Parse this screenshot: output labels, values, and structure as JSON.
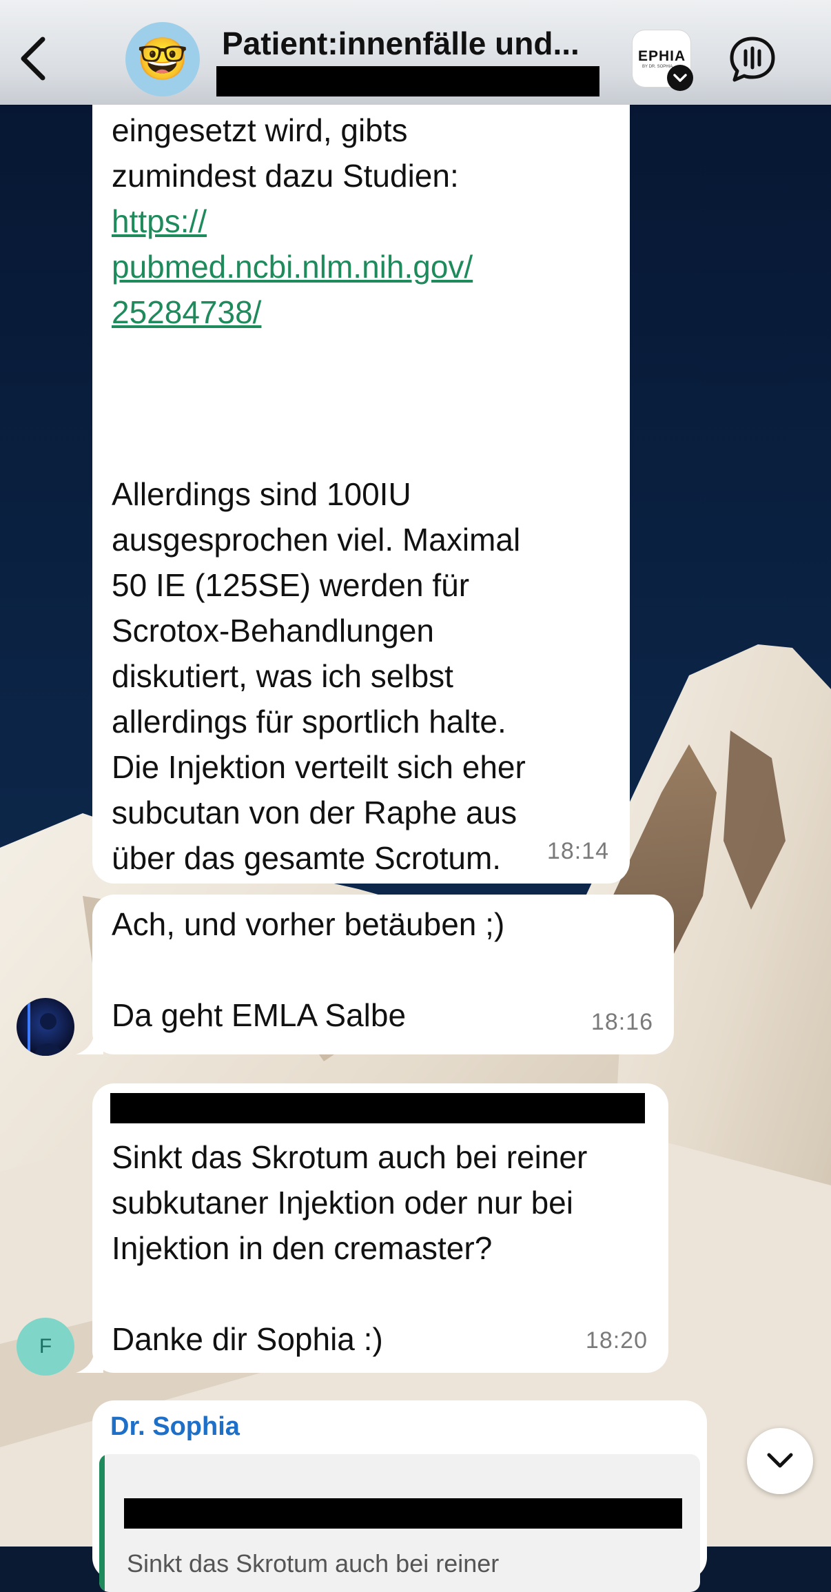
{
  "header": {
    "title": "Patient:innenfälle und...",
    "group_avatar_emoji": "🤓",
    "community_icon_label": "EPHIA",
    "community_icon_sublabel": "BY DR. SOPHIA"
  },
  "messages": [
    {
      "lines_1": [
        "eingesetzt wird, gibts",
        "zumindest dazu Studien:"
      ],
      "link_lines": [
        "https://",
        "pubmed.ncbi.nlm.nih.gov/",
        "25284738/"
      ],
      "lines_2": [
        "Allerdings sind 100IU",
        "ausgesprochen viel. Maximal",
        "50 IE (125SE) werden für",
        "Scrotox-Behandlungen",
        "diskutiert, was ich selbst",
        "allerdings für sportlich halte.",
        "Die Injektion verteilt sich eher",
        "subcutan von der Raphe aus",
        "über das gesamte Scrotum."
      ],
      "time": "18:14"
    },
    {
      "line_1": "Ach, und vorher betäuben ;)",
      "line_2": "Da geht EMLA Salbe",
      "time": "18:16"
    },
    {
      "lines": [
        "Sinkt das Skrotum auch bei reiner",
        "subkutaner Injektion oder nur bei",
        "Injektion in den cremaster?"
      ],
      "line_last": "Danke dir Sophia :)",
      "time": "18:20",
      "avatar_initial": "F"
    },
    {
      "sender": "Dr. Sophia",
      "quote_text": "Sinkt das Skrotum auch bei reiner"
    }
  ],
  "colors": {
    "link": "#1f8a5b",
    "sender_name": "#1e6fc8",
    "quote_bar": "#1f8a5b",
    "avatar_f_bg": "#7fd6c8",
    "avatar_f_text": "#1c6f63"
  }
}
